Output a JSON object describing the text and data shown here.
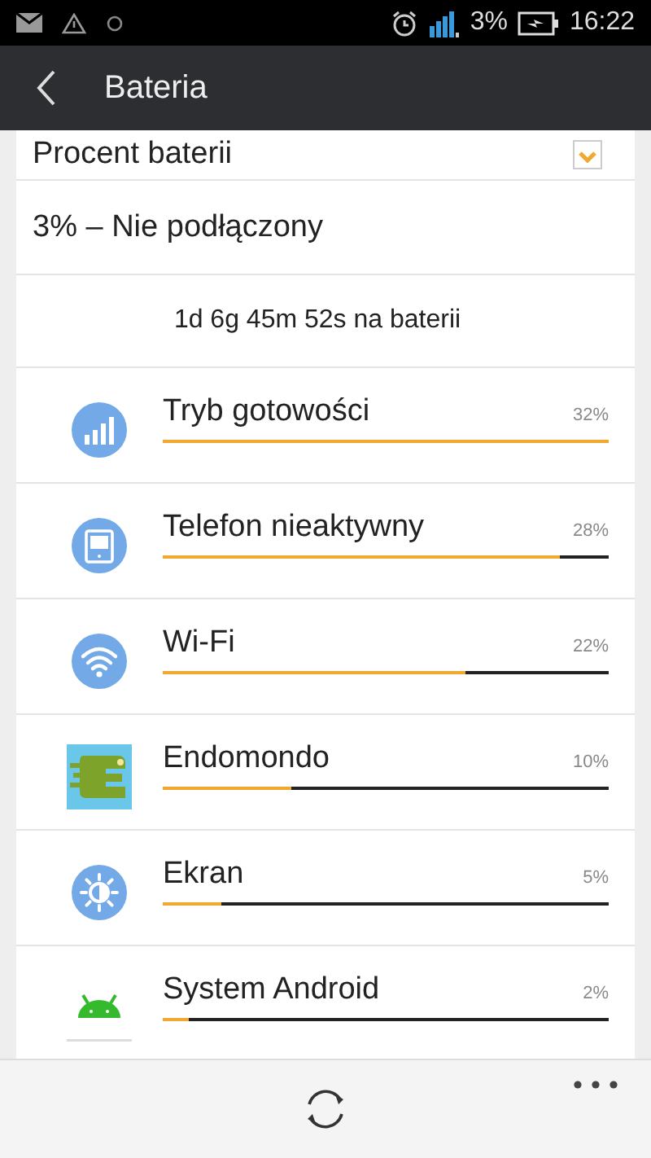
{
  "status_bar": {
    "battery_percent": "3%",
    "time": "16:22"
  },
  "header": {
    "title": "Bateria"
  },
  "settings": [
    {
      "label": "Procent baterii",
      "checked": true
    },
    {
      "label": "3% – Nie podłączony"
    }
  ],
  "summary": "1d 6g 45m 52s na baterii",
  "usage": [
    {
      "kind": "standby",
      "name": "Tryb gotowości",
      "percent": "32%",
      "level": 1.0
    },
    {
      "kind": "idle",
      "name": "Telefon nieaktywny",
      "percent": "28%",
      "level": 0.89
    },
    {
      "kind": "wifi",
      "name": "Wi-Fi",
      "percent": "22%",
      "level": 0.68
    },
    {
      "kind": "fitness-app",
      "name": "Endomondo",
      "percent": "10%",
      "level": 0.29
    },
    {
      "kind": "screen",
      "name": "Ekran",
      "percent": "5%",
      "level": 0.13
    },
    {
      "kind": "android",
      "name": "System Android",
      "percent": "2%",
      "level": 0.06
    }
  ]
}
